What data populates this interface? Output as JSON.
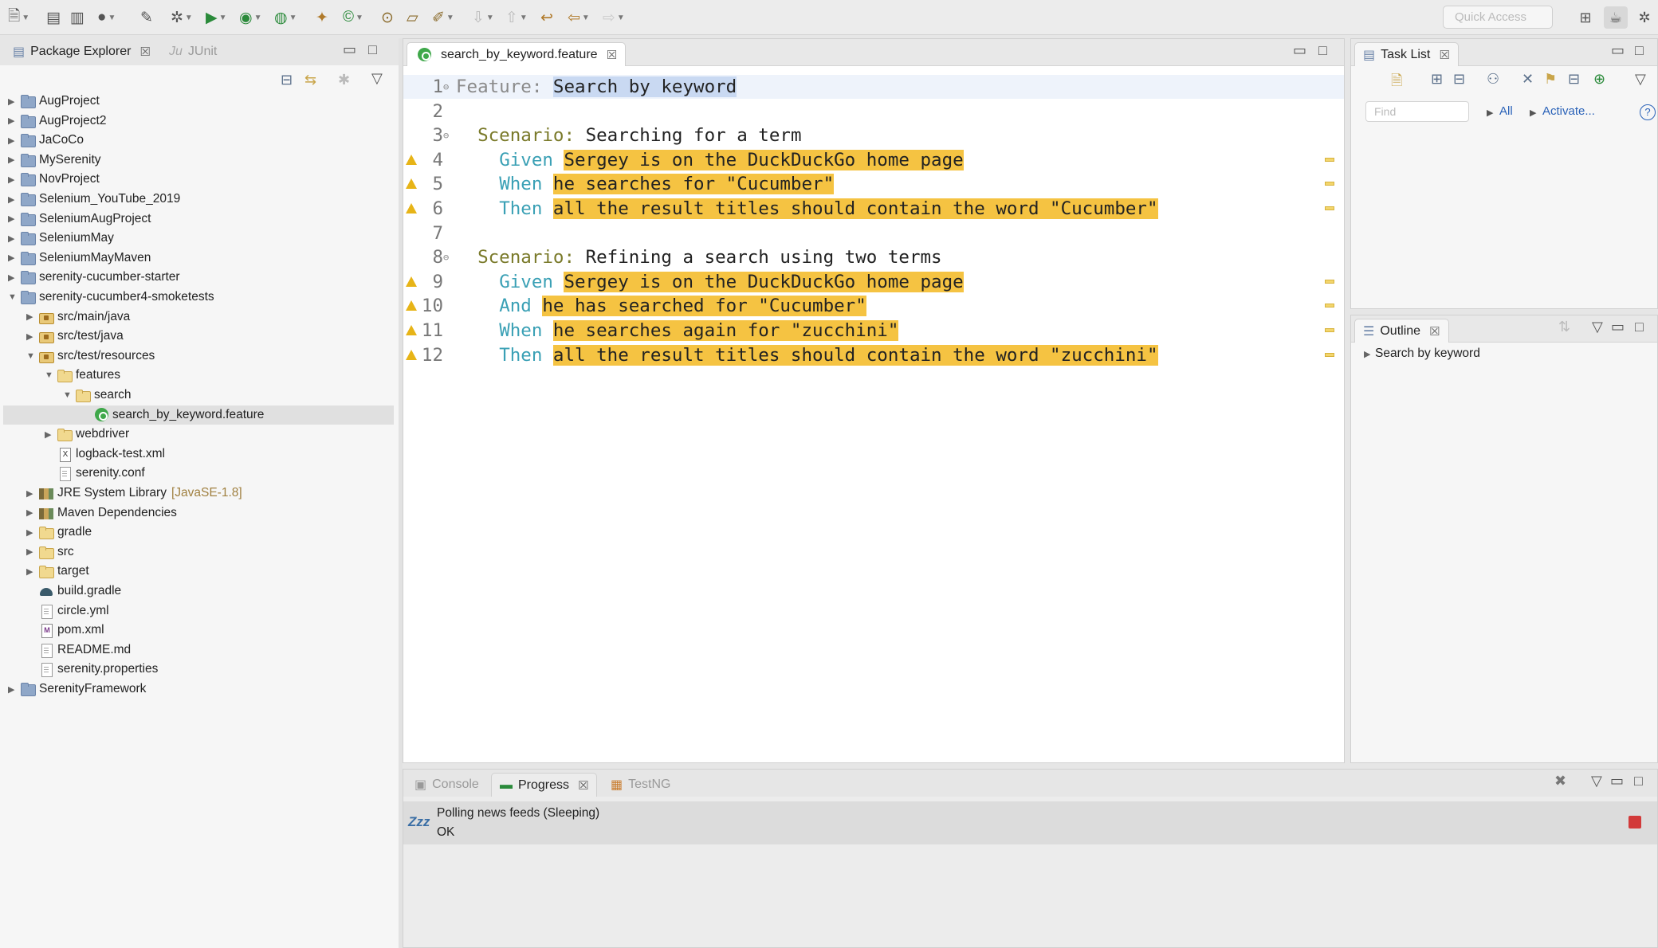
{
  "toolbar": {
    "quick_access_placeholder": "Quick Access"
  },
  "package_explorer": {
    "tab_label": "Package Explorer",
    "junit_tab_label": "JUnit",
    "tree": [
      {
        "label": "AugProject",
        "depth": 0,
        "twisty": "▶",
        "icon": "project"
      },
      {
        "label": "AugProject2",
        "depth": 0,
        "twisty": "▶",
        "icon": "project"
      },
      {
        "label": "JaCoCo",
        "depth": 0,
        "twisty": "▶",
        "icon": "project"
      },
      {
        "label": "MySerenity",
        "depth": 0,
        "twisty": "▶",
        "icon": "project"
      },
      {
        "label": "NovProject",
        "depth": 0,
        "twisty": "▶",
        "icon": "project"
      },
      {
        "label": "Selenium_YouTube_2019",
        "depth": 0,
        "twisty": "▶",
        "icon": "project"
      },
      {
        "label": "SeleniumAugProject",
        "depth": 0,
        "twisty": "▶",
        "icon": "project"
      },
      {
        "label": "SeleniumMay",
        "depth": 0,
        "twisty": "▶",
        "icon": "project"
      },
      {
        "label": "SeleniumMayMaven",
        "depth": 0,
        "twisty": "▶",
        "icon": "project"
      },
      {
        "label": "serenity-cucumber-starter",
        "depth": 0,
        "twisty": "▶",
        "icon": "project"
      },
      {
        "label": "serenity-cucumber4-smoketests",
        "depth": 0,
        "twisty": "▼",
        "icon": "project"
      },
      {
        "label": "src/main/java",
        "depth": 1,
        "twisty": "▶",
        "icon": "pkgfolder"
      },
      {
        "label": "src/test/java",
        "depth": 1,
        "twisty": "▶",
        "icon": "pkgfolder"
      },
      {
        "label": "src/test/resources",
        "depth": 1,
        "twisty": "▼",
        "icon": "pkgfolder"
      },
      {
        "label": "features",
        "depth": 2,
        "twisty": "▼",
        "icon": "folder"
      },
      {
        "label": "search",
        "depth": 3,
        "twisty": "▼",
        "icon": "folder"
      },
      {
        "label": "search_by_keyword.feature",
        "depth": 4,
        "twisty": "",
        "icon": "cuke",
        "selected": true
      },
      {
        "label": "webdriver",
        "depth": 2,
        "twisty": "▶",
        "icon": "folder"
      },
      {
        "label": "logback-test.xml",
        "depth": 2,
        "twisty": "",
        "icon": "xml"
      },
      {
        "label": "serenity.conf",
        "depth": 2,
        "twisty": "",
        "icon": "file"
      },
      {
        "label": "JRE System Library",
        "depth": 1,
        "twisty": "▶",
        "icon": "lib",
        "decoration": "[JavaSE-1.8]"
      },
      {
        "label": "Maven Dependencies",
        "depth": 1,
        "twisty": "▶",
        "icon": "lib"
      },
      {
        "label": "gradle",
        "depth": 1,
        "twisty": "▶",
        "icon": "folder"
      },
      {
        "label": "src",
        "depth": 1,
        "twisty": "▶",
        "icon": "folder"
      },
      {
        "label": "target",
        "depth": 1,
        "twisty": "▶",
        "icon": "folder"
      },
      {
        "label": "build.gradle",
        "depth": 1,
        "twisty": "",
        "icon": "gradle"
      },
      {
        "label": "circle.yml",
        "depth": 1,
        "twisty": "",
        "icon": "file"
      },
      {
        "label": "pom.xml",
        "depth": 1,
        "twisty": "",
        "icon": "m"
      },
      {
        "label": "README.md",
        "depth": 1,
        "twisty": "",
        "icon": "file"
      },
      {
        "label": "serenity.properties",
        "depth": 1,
        "twisty": "",
        "icon": "file"
      },
      {
        "label": "SerenityFramework",
        "depth": 0,
        "twisty": "▶",
        "icon": "project"
      }
    ]
  },
  "editor": {
    "tab_label": "search_by_keyword.feature",
    "lines": [
      {
        "n": "1",
        "fold": true,
        "warn": false,
        "current": true,
        "parts": [
          [
            "kw-feature",
            "Feature: "
          ],
          [
            "hl-sel",
            "Search by keyword"
          ]
        ]
      },
      {
        "n": "2",
        "fold": false,
        "warn": false,
        "parts": []
      },
      {
        "n": "3",
        "fold": true,
        "warn": false,
        "parts": [
          [
            "plain",
            "  "
          ],
          [
            "kw-scenario",
            "Scenario: "
          ],
          [
            "plain",
            "Searching for a term"
          ]
        ]
      },
      {
        "n": "4",
        "fold": false,
        "warn": true,
        "parts": [
          [
            "plain",
            "    "
          ],
          [
            "kw-step",
            "Given "
          ],
          [
            "hl-yellow",
            "Sergey is on the DuckDuckGo home page"
          ]
        ]
      },
      {
        "n": "5",
        "fold": false,
        "warn": true,
        "parts": [
          [
            "plain",
            "    "
          ],
          [
            "kw-step",
            "When "
          ],
          [
            "hl-yellow",
            "he searches for \"Cucumber\""
          ]
        ]
      },
      {
        "n": "6",
        "fold": false,
        "warn": true,
        "parts": [
          [
            "plain",
            "    "
          ],
          [
            "kw-step",
            "Then "
          ],
          [
            "hl-yellow",
            "all the result titles should contain the word \"Cucumber\""
          ]
        ]
      },
      {
        "n": "7",
        "fold": false,
        "warn": false,
        "parts": []
      },
      {
        "n": "8",
        "fold": true,
        "warn": false,
        "parts": [
          [
            "plain",
            "  "
          ],
          [
            "kw-scenario",
            "Scenario: "
          ],
          [
            "plain",
            "Refining a search using two terms"
          ]
        ]
      },
      {
        "n": "9",
        "fold": false,
        "warn": true,
        "parts": [
          [
            "plain",
            "    "
          ],
          [
            "kw-step",
            "Given "
          ],
          [
            "hl-yellow",
            "Sergey is on the DuckDuckGo home page"
          ]
        ]
      },
      {
        "n": "10",
        "fold": false,
        "warn": true,
        "parts": [
          [
            "plain",
            "    "
          ],
          [
            "kw-step",
            "And "
          ],
          [
            "hl-yellow",
            "he has searched for \"Cucumber\""
          ]
        ]
      },
      {
        "n": "11",
        "fold": false,
        "warn": true,
        "parts": [
          [
            "plain",
            "    "
          ],
          [
            "kw-step",
            "When "
          ],
          [
            "hl-yellow",
            "he searches again for \"zucchini\""
          ]
        ]
      },
      {
        "n": "12",
        "fold": false,
        "warn": true,
        "parts": [
          [
            "plain",
            "    "
          ],
          [
            "kw-step",
            "Then "
          ],
          [
            "hl-yellow",
            "all the result titles should contain the word \"zucchini\""
          ]
        ]
      }
    ]
  },
  "task_list": {
    "tab_label": "Task List",
    "find_placeholder": "Find",
    "all_label": "All",
    "activate_label": "Activate..."
  },
  "outline": {
    "tab_label": "Outline",
    "root_label": "Search by keyword"
  },
  "bottom": {
    "console_tab": "Console",
    "progress_tab": "Progress",
    "testng_tab": "TestNG",
    "zzz_label": "Zzz",
    "poll_text": "Polling news feeds (Sleeping)",
    "ok_text": "OK"
  },
  "colors": {
    "highlight": "#f5c342",
    "step_keyword": "#3aa0b5",
    "scenario_keyword": "#7a7a2a",
    "selection": "#c9d9f2"
  }
}
